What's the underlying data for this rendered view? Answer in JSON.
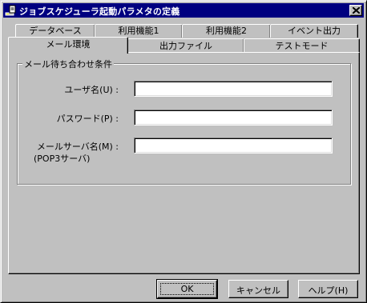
{
  "window": {
    "title": "ジョブスケジューラ起動パラメタの定義",
    "close_icon": "close-icon",
    "app_icon": "app-icon"
  },
  "tabs": {
    "row_back": [
      "データベース",
      "利用機能1",
      "利用機能2",
      "イベント出力"
    ],
    "row_front": [
      "メール環境",
      "出力ファイル",
      "テストモード"
    ],
    "active": "メール環境"
  },
  "group": {
    "label": "メール待ち合わせ条件",
    "fields": [
      {
        "label": "ユーザ名(U) :",
        "value": ""
      },
      {
        "label": "パスワード(P) :",
        "value": ""
      },
      {
        "label": "メールサーバ名(M) :",
        "label2": "(POP3サーバ)",
        "value": ""
      }
    ]
  },
  "buttons": {
    "ok": "OK",
    "cancel": "キャンセル",
    "help": "ヘルプ(H)"
  }
}
